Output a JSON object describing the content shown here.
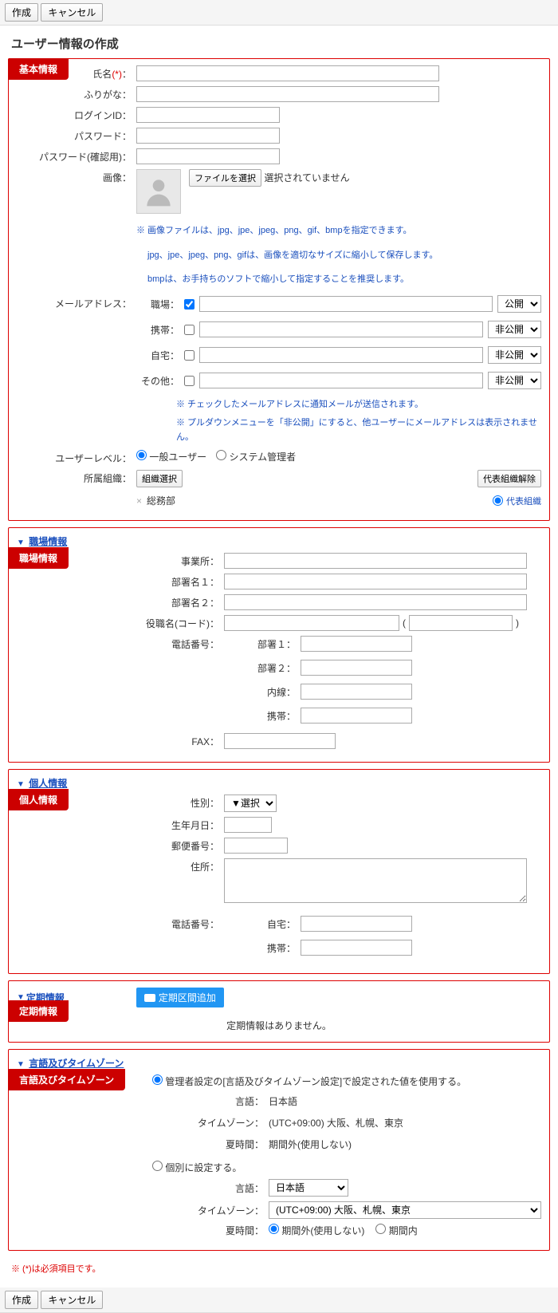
{
  "toolbar": {
    "create": "作成",
    "cancel": "キャンセル"
  },
  "page_title": "ユーザー情報の作成",
  "basic": {
    "title": "基本情報",
    "name_label": "氏名",
    "required": "(*)",
    "colon": "：",
    "furigana_label": "ふりがな：",
    "login_label": "ログインID：",
    "password_label": "パスワード：",
    "password_confirm_label": "パスワード(確認用)：",
    "image_label": "画像：",
    "file_btn": "ファイルを選択",
    "file_none": "選択されていません",
    "image_note1": "※ 画像ファイルは、jpg、jpe、jpeg、png、gif、bmpを指定できます。",
    "image_note2": "jpg、jpe、jpeg、png、gifは、画像を適切なサイズに縮小して保存します。",
    "image_note3": "bmpは、お手持ちのソフトで縮小して指定することを推奨します。",
    "mail_label": "メールアドレス：",
    "mail_work": "職場：",
    "mail_mobile": "携帯：",
    "mail_home": "自宅：",
    "mail_other": "その他：",
    "vis_public": "公開",
    "vis_private": "非公開",
    "mail_note1": "※ チェックしたメールアドレスに通知メールが送信されます。",
    "mail_note2": "※ プルダウンメニューを「非公開」にすると、他ユーザーにメールアドレスは表示されません。",
    "level_label": "ユーザーレベル：",
    "level_normal": "一般ユーザー",
    "level_admin": "システム管理者",
    "org_label": "所属組織：",
    "org_select_btn": "組織選択",
    "rep_release_btn": "代表組織解除",
    "org_name": "総務部",
    "rep_org": "代表組織"
  },
  "work": {
    "link": "職場情報",
    "title": "職場情報",
    "office": "事業所：",
    "dept1": "部署名１：",
    "dept2": "部署名２：",
    "position": "役職名(コード)：",
    "paren_l": "(",
    "paren_r": ")",
    "tel_label": "電話番号：",
    "tel_dept1": "部署１：",
    "tel_dept2": "部署２：",
    "tel_ext": "内線：",
    "tel_mobile": "携帯：",
    "fax": "FAX："
  },
  "personal": {
    "link": "個人情報",
    "title": "個人情報",
    "gender": "性別：",
    "gender_sel": "▼選択",
    "birth": "生年月日：",
    "zip": "郵便番号：",
    "addr": "住所：",
    "tel_label": "電話番号：",
    "tel_home": "自宅：",
    "tel_mobile": "携帯："
  },
  "teiki": {
    "link": "定期情報",
    "title": "定期情報",
    "add_btn": "定期区間追加",
    "none": "定期情報はありません。"
  },
  "locale": {
    "link": "言語及びタイムゾーン",
    "title": "言語及びタイムゾーン",
    "opt_admin": "管理者設定の[言語及びタイムゾーン設定]で設定された値を使用する。",
    "opt_indiv": "個別に設定する。",
    "lang_label": "言語：",
    "lang_ja": "日本語",
    "tz_label": "タイムゾーン：",
    "tz_val": "(UTC+09:00) 大阪、札幌、東京",
    "dst_label": "夏時間：",
    "dst_off": "期間外(使用しない)",
    "dst_on": "期間内"
  },
  "footnote": "※ (*)は必須項目です。"
}
